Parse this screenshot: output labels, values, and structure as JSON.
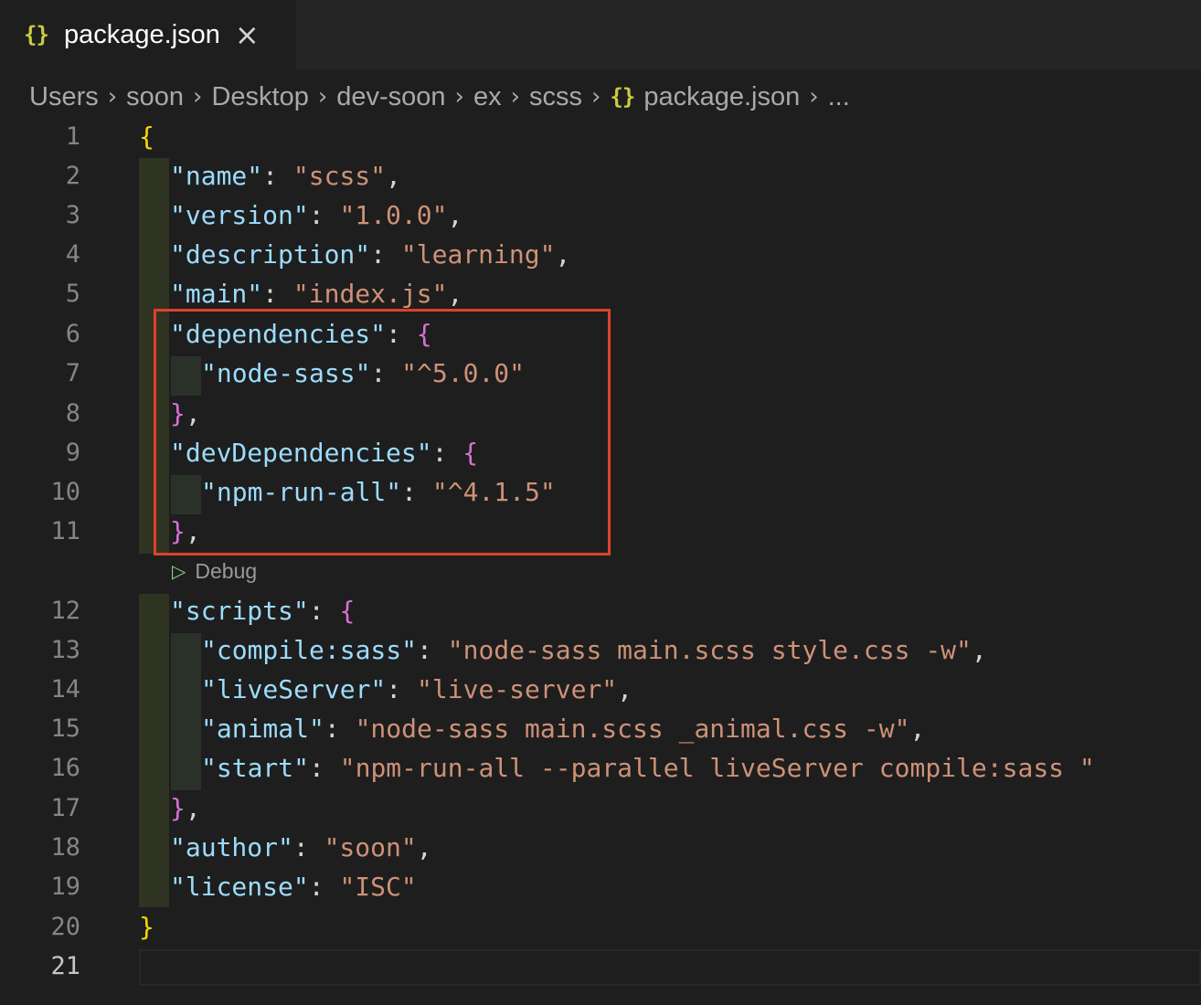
{
  "tab": {
    "icon": "json-braces-icon",
    "icon_text": "{}",
    "title": "package.json",
    "close": "×"
  },
  "breadcrumb": {
    "items": [
      "Users",
      "soon",
      "Desktop",
      "dev-soon",
      "ex",
      "scss"
    ],
    "file_icon_text": "{}",
    "file": "package.json",
    "ellipsis": "..."
  },
  "editor": {
    "debug_lens": "Debug",
    "active_line": "21",
    "line_numbers": [
      "1",
      "2",
      "3",
      "4",
      "5",
      "6",
      "7",
      "8",
      "9",
      "10",
      "11",
      "12",
      "13",
      "14",
      "15",
      "16",
      "17",
      "18",
      "19",
      "20",
      "21"
    ],
    "lines": {
      "l1": {
        "open": "{"
      },
      "l2": {
        "key": "\"name\"",
        "val": "\"scss\""
      },
      "l3": {
        "key": "\"version\"",
        "val": "\"1.0.0\""
      },
      "l4": {
        "key": "\"description\"",
        "val": "\"learning\""
      },
      "l5": {
        "key": "\"main\"",
        "val": "\"index.js\""
      },
      "l6": {
        "key": "\"dependencies\"",
        "open": "{"
      },
      "l7": {
        "key": "\"node-sass\"",
        "val": "\"^5.0.0\""
      },
      "l8": {
        "close": "}"
      },
      "l9": {
        "key": "\"devDependencies\"",
        "open": "{"
      },
      "l10": {
        "key": "\"npm-run-all\"",
        "val": "\"^4.1.5\""
      },
      "l11": {
        "close": "}"
      },
      "l12": {
        "key": "\"scripts\"",
        "open": "{"
      },
      "l13": {
        "key": "\"compile:sass\"",
        "val": "\"node-sass main.scss style.css -w\""
      },
      "l14": {
        "key": "\"liveServer\"",
        "val": "\"live-server\""
      },
      "l15": {
        "key": "\"animal\"",
        "val": "\"node-sass main.scss _animal.css -w\""
      },
      "l16": {
        "key": "\"start\"",
        "val": "\"npm-run-all --parallel liveServer compile:sass \""
      },
      "l17": {
        "close": "}"
      },
      "l18": {
        "key": "\"author\"",
        "val": "\"soon\""
      },
      "l19": {
        "key": "\"license\"",
        "val": "\"ISC\""
      },
      "l20": {
        "close": "}"
      }
    }
  },
  "colors": {
    "background": "#1e1e1e",
    "json_key": "#9cdcfe",
    "json_string": "#ce9178",
    "bracket_level1": "#ffd700",
    "bracket_level2": "#da70d6",
    "highlight_box": "#e0402b"
  }
}
